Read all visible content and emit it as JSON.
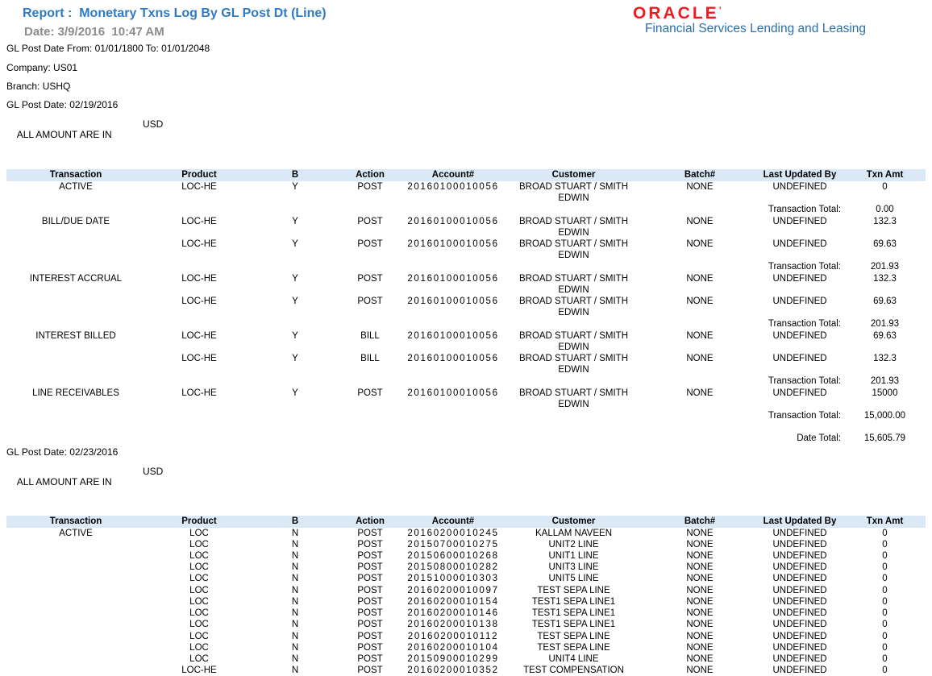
{
  "report": {
    "title": "Report :  Monetary Txns Log By GL Post Dt (Line)",
    "date": "Date: 3/9/2016  10:47 AM",
    "range": "GL Post Date From: 01/01/1800 To: 01/01/2048",
    "company": "Company: US01",
    "branch": "Branch: USHQ"
  },
  "logo": {
    "brand": "ORACLE",
    "mark": "’",
    "product": "Financial Services Lending and Leasing"
  },
  "colors": {
    "title_blue": "#2f7ac5",
    "date_gray": "#8c8c8c",
    "oracle_red": "#ed1d24",
    "product_blue": "#2a6fad",
    "table_header_bg": "#dbe9f7"
  },
  "columns": [
    "Transaction",
    "Product",
    "B",
    "Action",
    "Account#",
    "Customer",
    "Batch#",
    "Last Updated By",
    "Txn Amt"
  ],
  "sections": [
    {
      "gl_post_date": "GL Post Date: 02/19/2016",
      "amount_note": "ALL AMOUNT ARE IN",
      "currency": "USD",
      "rows": [
        {
          "type": "data",
          "cells": [
            "ACTIVE",
            "LOC-HE",
            "Y",
            "POST",
            "20160100010056",
            "BROAD STUART / SMITH\nEDWIN",
            "NONE",
            "UNDEFINED",
            "0"
          ]
        },
        {
          "type": "total",
          "label": "Transaction Total:",
          "amount": "0.00"
        },
        {
          "type": "data",
          "cells": [
            "BILL/DUE DATE",
            "LOC-HE",
            "Y",
            "POST",
            "20160100010056",
            "BROAD STUART / SMITH\nEDWIN",
            "NONE",
            "UNDEFINED",
            "132.3"
          ]
        },
        {
          "type": "data",
          "cells": [
            "",
            "LOC-HE",
            "Y",
            "POST",
            "20160100010056",
            "BROAD STUART / SMITH\nEDWIN",
            "NONE",
            "UNDEFINED",
            "69.63"
          ]
        },
        {
          "type": "total",
          "label": "Transaction Total:",
          "amount": "201.93"
        },
        {
          "type": "data",
          "cells": [
            "INTEREST ACCRUAL",
            "LOC-HE",
            "Y",
            "POST",
            "20160100010056",
            "BROAD STUART / SMITH\nEDWIN",
            "NONE",
            "UNDEFINED",
            "132.3"
          ]
        },
        {
          "type": "data",
          "cells": [
            "",
            "LOC-HE",
            "Y",
            "POST",
            "20160100010056",
            "BROAD STUART / SMITH\nEDWIN",
            "NONE",
            "UNDEFINED",
            "69.63"
          ]
        },
        {
          "type": "total",
          "label": "Transaction Total:",
          "amount": "201.93"
        },
        {
          "type": "data",
          "cells": [
            "INTEREST BILLED",
            "LOC-HE",
            "Y",
            "BILL",
            "20160100010056",
            "BROAD STUART / SMITH\nEDWIN",
            "NONE",
            "UNDEFINED",
            "69.63"
          ]
        },
        {
          "type": "data",
          "cells": [
            "",
            "LOC-HE",
            "Y",
            "BILL",
            "20160100010056",
            "BROAD STUART / SMITH\nEDWIN",
            "NONE",
            "UNDEFINED",
            "132.3"
          ]
        },
        {
          "type": "total",
          "label": "Transaction Total:",
          "amount": "201.93"
        },
        {
          "type": "data",
          "cells": [
            "LINE RECEIVABLES",
            "LOC-HE",
            "Y",
            "POST",
            "20160100010056",
            "BROAD STUART / SMITH\nEDWIN",
            "NONE",
            "UNDEFINED",
            "15000"
          ]
        },
        {
          "type": "total",
          "label": "Transaction Total:",
          "amount": "15,000.00"
        },
        {
          "type": "blank"
        },
        {
          "type": "total",
          "label": "Date Total:",
          "amount": "15,605.79"
        }
      ]
    },
    {
      "gl_post_date": "GL Post Date: 02/23/2016",
      "amount_note": "ALL AMOUNT ARE IN",
      "currency": "USD",
      "rows": [
        {
          "type": "data",
          "cells": [
            "ACTIVE",
            "LOC",
            "N",
            "POST",
            "20160200010245",
            "KALLAM NAVEEN",
            "NONE",
            "UNDEFINED",
            "0"
          ]
        },
        {
          "type": "data",
          "cells": [
            "",
            "LOC",
            "N",
            "POST",
            "20150700010275",
            "UNIT2 LINE",
            "NONE",
            "UNDEFINED",
            "0"
          ]
        },
        {
          "type": "data",
          "cells": [
            "",
            "LOC",
            "N",
            "POST",
            "20150600010268",
            "UNIT1 LINE",
            "NONE",
            "UNDEFINED",
            "0"
          ]
        },
        {
          "type": "data",
          "cells": [
            "",
            "LOC",
            "N",
            "POST",
            "20150800010282",
            "UNIT3 LINE",
            "NONE",
            "UNDEFINED",
            "0"
          ]
        },
        {
          "type": "data",
          "cells": [
            "",
            "LOC",
            "N",
            "POST",
            "20151000010303",
            "UNIT5 LINE",
            "NONE",
            "UNDEFINED",
            "0"
          ]
        },
        {
          "type": "data",
          "cells": [
            "",
            "LOC",
            "N",
            "POST",
            "20160200010097",
            "TEST SEPA LINE",
            "NONE",
            "UNDEFINED",
            "0"
          ]
        },
        {
          "type": "data",
          "cells": [
            "",
            "LOC",
            "N",
            "POST",
            "20160200010154",
            "TEST1 SEPA LINE1",
            "NONE",
            "UNDEFINED",
            "0"
          ]
        },
        {
          "type": "data",
          "cells": [
            "",
            "LOC",
            "N",
            "POST",
            "20160200010146",
            "TEST1 SEPA LINE1",
            "NONE",
            "UNDEFINED",
            "0"
          ]
        },
        {
          "type": "data",
          "cells": [
            "",
            "LOC",
            "N",
            "POST",
            "20160200010138",
            "TEST1 SEPA LINE1",
            "NONE",
            "UNDEFINED",
            "0"
          ]
        },
        {
          "type": "data",
          "cells": [
            "",
            "LOC",
            "N",
            "POST",
            "20160200010112",
            "TEST SEPA LINE",
            "NONE",
            "UNDEFINED",
            "0"
          ]
        },
        {
          "type": "data",
          "cells": [
            "",
            "LOC",
            "N",
            "POST",
            "20160200010104",
            "TEST SEPA LINE",
            "NONE",
            "UNDEFINED",
            "0"
          ]
        },
        {
          "type": "data",
          "cells": [
            "",
            "LOC",
            "N",
            "POST",
            "20150900010299",
            "UNIT4 LINE",
            "NONE",
            "UNDEFINED",
            "0"
          ]
        },
        {
          "type": "data",
          "cells": [
            "",
            "LOC-HE",
            "N",
            "POST",
            "20160200010352",
            "TEST COMPENSATION",
            "NONE",
            "UNDEFINED",
            "0"
          ]
        }
      ]
    }
  ]
}
